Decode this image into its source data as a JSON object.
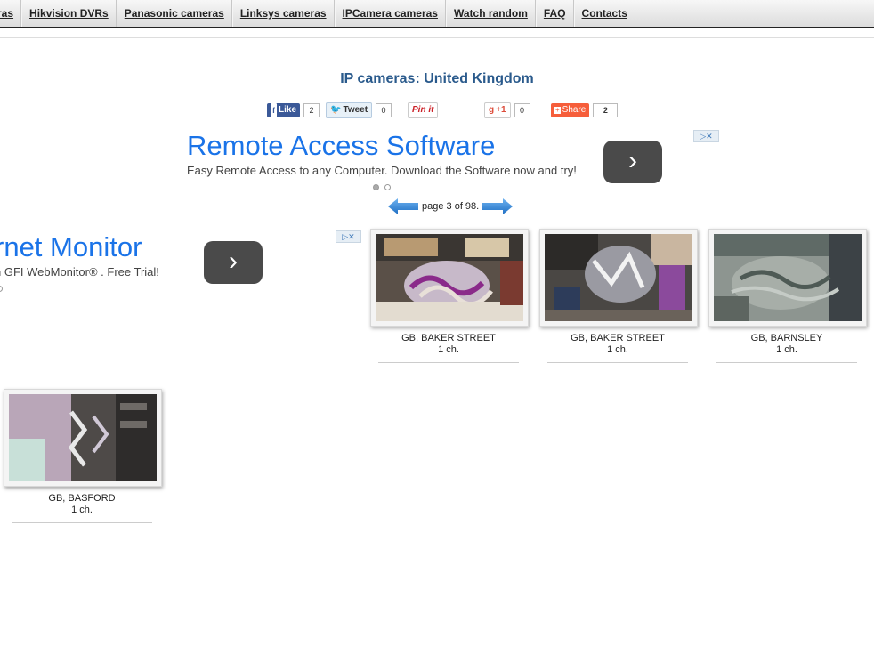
{
  "nav": {
    "items": [
      "ras",
      "Hikvision DVRs",
      "Panasonic cameras",
      "Linksys cameras",
      "IPCamera cameras",
      "Watch random",
      "FAQ",
      "Contacts"
    ]
  },
  "page": {
    "title": "IP cameras: United Kingdom"
  },
  "share": {
    "like_label": "Like",
    "like_count": "2",
    "tweet_label": "Tweet",
    "tweet_count": "0",
    "pin_label": "Pin it",
    "gplus_label": "+1",
    "gplus_count": "0",
    "share_label": "Share",
    "share_count": "2"
  },
  "ad_main": {
    "title": "Remote Access Software",
    "desc": "Easy Remote Access to any Computer. Download the Software now and try!"
  },
  "ad_side": {
    "title": "rnet Monitor",
    "desc": "n GFI WebMonitor® . Free Trial!"
  },
  "pager": {
    "text": "page 3 of 98."
  },
  "cameras": [
    {
      "location": "GB, BAKER STREET",
      "channels": "1 ch."
    },
    {
      "location": "GB, BAKER STREET",
      "channels": "1 ch."
    },
    {
      "location": "GB, BARNSLEY",
      "channels": "1 ch."
    },
    {
      "location": "GB, BASFORD",
      "channels": "1 ch."
    }
  ],
  "colors": {
    "title": "#2a5a8c",
    "ad_title": "#1a73e8",
    "facebook": "#3b5998",
    "twitter": "#55acee",
    "pinterest": "#cb2027",
    "share": "#f65e3b"
  }
}
